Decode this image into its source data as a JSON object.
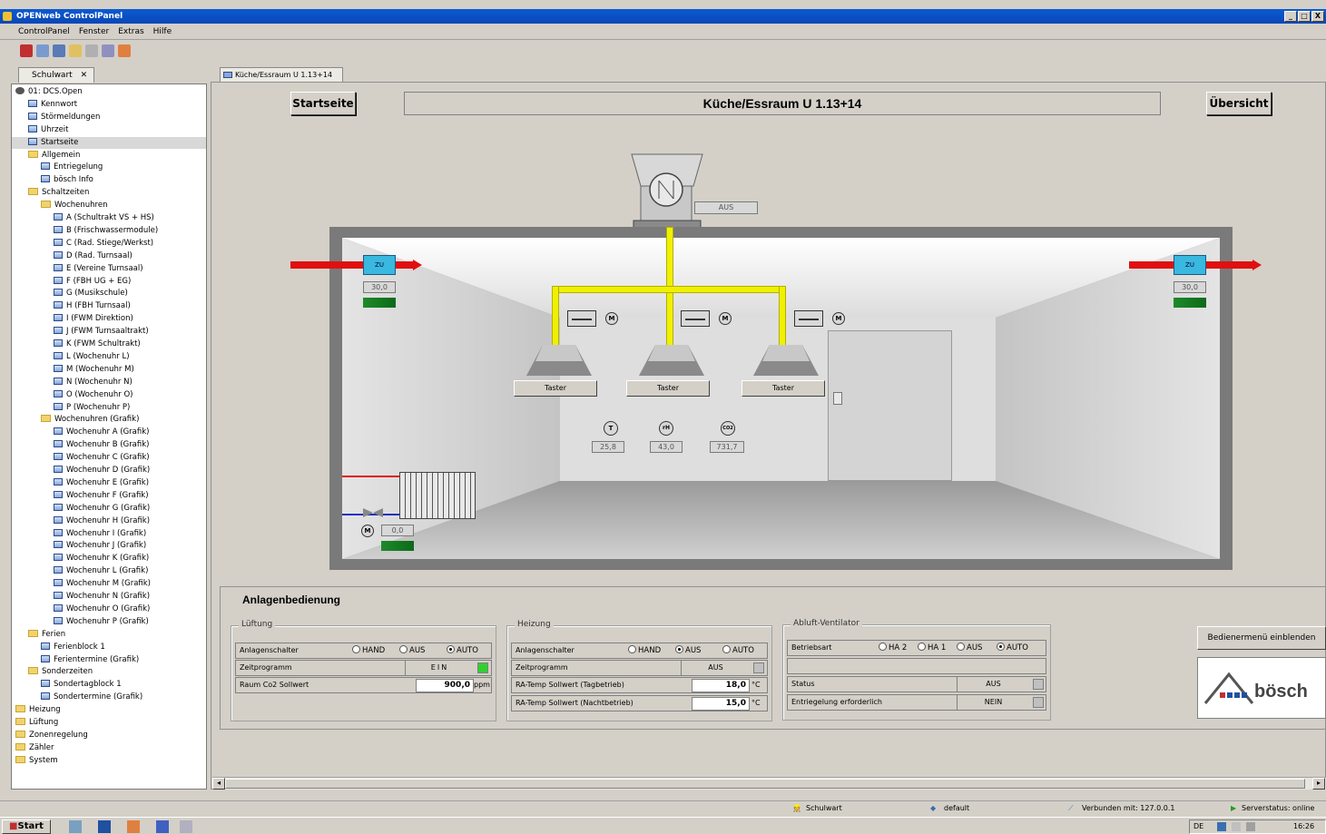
{
  "window": {
    "title": "OPENweb ControlPanel",
    "controls": [
      "_",
      "□",
      "X"
    ]
  },
  "menu": [
    "ControlPanel",
    "Fenster",
    "Extras",
    "Hilfe"
  ],
  "tree": {
    "tab_label": "Schulwart",
    "items": [
      {
        "label": "01: DCS.Open",
        "level": 0,
        "type": "root"
      },
      {
        "label": "Kennwort",
        "level": 1,
        "type": "page"
      },
      {
        "label": "Störmeldungen",
        "level": 1,
        "type": "page"
      },
      {
        "label": "Uhrzeit",
        "level": 1,
        "type": "page"
      },
      {
        "label": "Startseite",
        "level": 1,
        "type": "page",
        "selected": true
      },
      {
        "label": "Allgemein",
        "level": 1,
        "type": "folder"
      },
      {
        "label": "Entriegelung",
        "level": 2,
        "type": "page"
      },
      {
        "label": "bösch Info",
        "level": 2,
        "type": "page"
      },
      {
        "label": "Schaltzeiten",
        "level": 1,
        "type": "folder"
      },
      {
        "label": "Wochenuhren",
        "level": 2,
        "type": "folder"
      },
      {
        "label": "A (Schultrakt VS + HS)",
        "level": 3,
        "type": "page"
      },
      {
        "label": "B (Frischwassermodule)",
        "level": 3,
        "type": "page"
      },
      {
        "label": "C (Rad. Stiege/Werkst)",
        "level": 3,
        "type": "page"
      },
      {
        "label": "D (Rad. Turnsaal)",
        "level": 3,
        "type": "page"
      },
      {
        "label": "E (Vereine Turnsaal)",
        "level": 3,
        "type": "page"
      },
      {
        "label": "F (FBH UG + EG)",
        "level": 3,
        "type": "page"
      },
      {
        "label": "G (Musikschule)",
        "level": 3,
        "type": "page"
      },
      {
        "label": "H (FBH Turnsaal)",
        "level": 3,
        "type": "page"
      },
      {
        "label": "I (FWM Direktion)",
        "level": 3,
        "type": "page"
      },
      {
        "label": "J (FWM Turnsaaltrakt)",
        "level": 3,
        "type": "page"
      },
      {
        "label": "K (FWM Schultrakt)",
        "level": 3,
        "type": "page"
      },
      {
        "label": "L (Wochenuhr L)",
        "level": 3,
        "type": "page"
      },
      {
        "label": "M (Wochenuhr M)",
        "level": 3,
        "type": "page"
      },
      {
        "label": "N (Wochenuhr N)",
        "level": 3,
        "type": "page"
      },
      {
        "label": "O (Wochenuhr O)",
        "level": 3,
        "type": "page"
      },
      {
        "label": "P (Wochenuhr P)",
        "level": 3,
        "type": "page"
      },
      {
        "label": "Wochenuhren (Grafik)",
        "level": 2,
        "type": "folder"
      },
      {
        "label": "Wochenuhr A (Grafik)",
        "level": 3,
        "type": "page"
      },
      {
        "label": "Wochenuhr B (Grafik)",
        "level": 3,
        "type": "page"
      },
      {
        "label": "Wochenuhr C (Grafik)",
        "level": 3,
        "type": "page"
      },
      {
        "label": "Wochenuhr D (Grafik)",
        "level": 3,
        "type": "page"
      },
      {
        "label": "Wochenuhr E (Grafik)",
        "level": 3,
        "type": "page"
      },
      {
        "label": "Wochenuhr F (Grafik)",
        "level": 3,
        "type": "page"
      },
      {
        "label": "Wochenuhr G (Grafik)",
        "level": 3,
        "type": "page"
      },
      {
        "label": "Wochenuhr H (Grafik)",
        "level": 3,
        "type": "page"
      },
      {
        "label": "Wochenuhr I (Grafik)",
        "level": 3,
        "type": "page"
      },
      {
        "label": "Wochenuhr J (Grafik)",
        "level": 3,
        "type": "page"
      },
      {
        "label": "Wochenuhr K (Grafik)",
        "level": 3,
        "type": "page"
      },
      {
        "label": "Wochenuhr L (Grafik)",
        "level": 3,
        "type": "page"
      },
      {
        "label": "Wochenuhr M (Grafik)",
        "level": 3,
        "type": "page"
      },
      {
        "label": "Wochenuhr N (Grafik)",
        "level": 3,
        "type": "page"
      },
      {
        "label": "Wochenuhr O (Grafik)",
        "level": 3,
        "type": "page"
      },
      {
        "label": "Wochenuhr P (Grafik)",
        "level": 3,
        "type": "page"
      },
      {
        "label": "Ferien",
        "level": 1,
        "type": "folder"
      },
      {
        "label": "Ferienblock 1",
        "level": 2,
        "type": "page"
      },
      {
        "label": "Ferientermine (Grafik)",
        "level": 2,
        "type": "page"
      },
      {
        "label": "Sonderzeiten",
        "level": 1,
        "type": "folder"
      },
      {
        "label": "Sondertagblock 1",
        "level": 2,
        "type": "page"
      },
      {
        "label": "Sondertermine (Grafik)",
        "level": 2,
        "type": "page"
      },
      {
        "label": "Heizung",
        "level": 0,
        "type": "folder"
      },
      {
        "label": "Lüftung",
        "level": 0,
        "type": "folder"
      },
      {
        "label": "Zonenregelung",
        "level": 0,
        "type": "folder"
      },
      {
        "label": "Zähler",
        "level": 0,
        "type": "folder"
      },
      {
        "label": "System",
        "level": 0,
        "type": "folder"
      }
    ]
  },
  "doc_tab": "Küche/Essraum U 1.13+14",
  "header": {
    "start_button": "Startseite",
    "title": "Küche/Essraum U 1.13+14",
    "overview_button": "Übersicht"
  },
  "fan": {
    "status": "AUS"
  },
  "dampers": {
    "left_value": "30,0",
    "right_value": "30,0",
    "flow_icon": "ZU"
  },
  "taster": [
    "Taster",
    "Taster",
    "Taster"
  ],
  "motor_label": "M",
  "sensors": {
    "t_label": "T",
    "t_value": "25,8",
    "h_label": "rH",
    "h_value": "43,0",
    "co2_label": "CO2",
    "co2_value": "731,7"
  },
  "radiator": {
    "valve_value": "0,0"
  },
  "controls": {
    "title": "Anlagenbedienung",
    "lueftung": {
      "label": "Lüftung",
      "switch_label": "Anlagenschalter",
      "opt_hand": "HAND",
      "opt_aus": "AUS",
      "opt_auto": "AUTO",
      "selected": "AUTO",
      "zeit_label": "Zeitprogramm",
      "zeit_value": "EIN",
      "co2_label": "Raum Co2 Sollwert",
      "co2_value": "900,0",
      "co2_unit": "ppm"
    },
    "heizung": {
      "label": "Heizung",
      "switch_label": "Anlagenschalter",
      "opt_hand": "HAND",
      "opt_aus": "AUS",
      "opt_auto": "AUTO",
      "selected": "AUS",
      "zeit_label": "Zeitprogramm",
      "zeit_value": "AUS",
      "tag_label": "RA-Temp Sollwert (Tagbetrieb)",
      "tag_value": "18,0",
      "tag_unit": "°C",
      "nacht_label": "RA-Temp Sollwert (Nachtbetrieb)",
      "nacht_value": "15,0",
      "nacht_unit": "°C"
    },
    "abluft": {
      "label": "Abluft-Ventilator",
      "mode_label": "Betriebsart",
      "opt_ha2": "HA 2",
      "opt_ha1": "HA 1",
      "opt_aus": "AUS",
      "opt_auto": "AUTO",
      "selected": "AUTO",
      "status_label": "Status",
      "status_value": "AUS",
      "reset_label": "Entriegelung erforderlich",
      "reset_value": "NEIN"
    },
    "menu_button": "Bedienermenü einblenden",
    "logo_text": "bösch"
  },
  "statusbar": {
    "user": "Schulwart",
    "profile": "default",
    "connection": "Verbunden mit: 127.0.0.1",
    "server": "Serverstatus: online"
  },
  "taskbar": {
    "start": "Start",
    "lang": "DE",
    "time": "16:26"
  },
  "colors": {
    "duct_red": "#e01010",
    "pipe_yellow": "#f0f000",
    "green": "#1d8a2a",
    "led_green": "#30d030",
    "title_blue": "#0a4fc4"
  }
}
